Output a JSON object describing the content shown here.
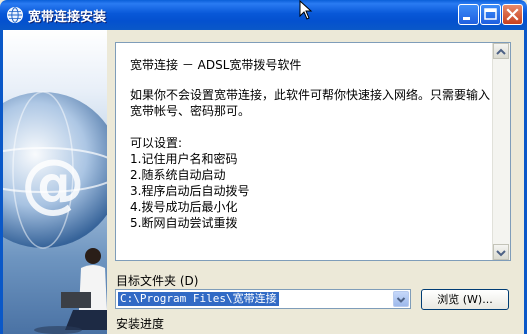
{
  "window": {
    "title": "宽带连接安装"
  },
  "info_text": {
    "heading": "宽带连接 － ADSL宽带拨号软件",
    "description": "如果你不会设置宽带连接，此软件可帮你快速接入网络。只需要输入宽带帐号、密码那可。",
    "features_heading": "可以设置:",
    "features": [
      "1.记住用户名和密码",
      "2.随系统自动启动",
      "3.程序启动后自动拨号",
      "4.拨号成功后最小化",
      "5.断网自动尝试重拨"
    ]
  },
  "target_folder": {
    "label": "目标文件夹 (D)",
    "value": "C:\\Program Files\\宽带连接",
    "browse_label": "浏览 (W)..."
  },
  "progress": {
    "label": "安装进度"
  },
  "colors": {
    "title_bar": "#0A58C8",
    "selection": "#316AC5",
    "close_button": "#C7401F"
  }
}
